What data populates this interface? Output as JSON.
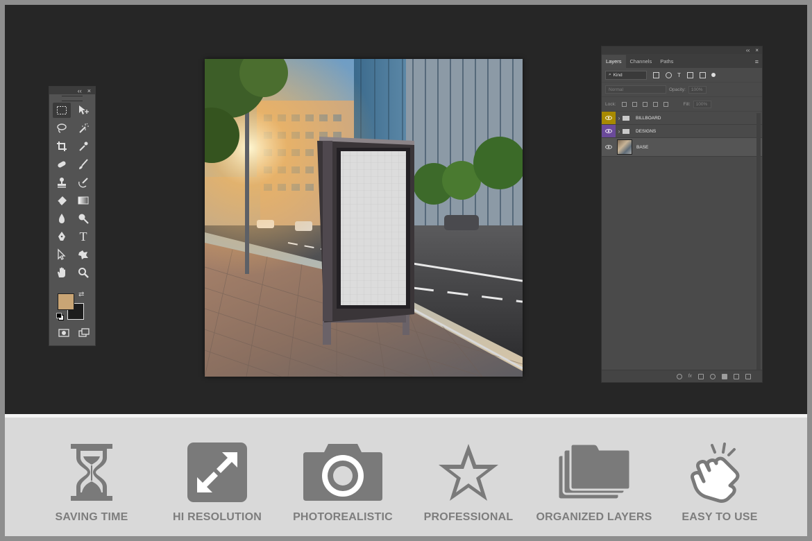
{
  "toolbar": {
    "collapse": "‹‹",
    "close": "×",
    "tools": [
      "rectangular-marquee",
      "move",
      "lasso",
      "magic-wand",
      "crop",
      "eyedropper",
      "spot-healing",
      "brush",
      "clone-stamp",
      "history-brush",
      "eraser",
      "gradient",
      "blur",
      "dodge",
      "pen",
      "type",
      "path-selection",
      "custom-shape",
      "hand",
      "zoom",
      "foreground-color",
      "background-color",
      "quick-mask",
      "screen-mode"
    ],
    "foreground_color": "#c9a575",
    "background_color": "#1d1d1d",
    "type_glyph": "T"
  },
  "layers_panel": {
    "tabs": [
      "Layers",
      "Channels",
      "Paths"
    ],
    "kind_label": "Kind",
    "blend_mode": "Normal",
    "opacity_label": "Opacity:",
    "opacity_value": "100%",
    "lock_label": "Lock:",
    "fill_label": "Fill:",
    "fill_value": "100%",
    "layers": [
      {
        "name": "BILLBOARD",
        "type": "group",
        "label_color": "#a88a00"
      },
      {
        "name": "DESIGNS",
        "type": "group",
        "label_color": "#6a4a9a"
      },
      {
        "name": "BASE",
        "type": "image"
      }
    ],
    "panel_menu": "≡",
    "collapse": "‹‹",
    "close": "×"
  },
  "features": [
    {
      "label": "SAVING TIME",
      "icon": "hourglass-icon"
    },
    {
      "label": "HI RESOLUTION",
      "icon": "expand-arrows-icon"
    },
    {
      "label": "PHOTOREALISTIC",
      "icon": "camera-icon"
    },
    {
      "label": "PROFESSIONAL",
      "icon": "star-icon"
    },
    {
      "label": "ORGANIZED LAYERS",
      "icon": "layers-stack-icon"
    },
    {
      "label": "EASY TO USE",
      "icon": "tap-hand-icon"
    }
  ],
  "colors": {
    "workspace": "#262626",
    "panel": "#4a4a4a",
    "feature_bg": "#d9d9d9",
    "feature_icon": "#7a7a7a"
  }
}
